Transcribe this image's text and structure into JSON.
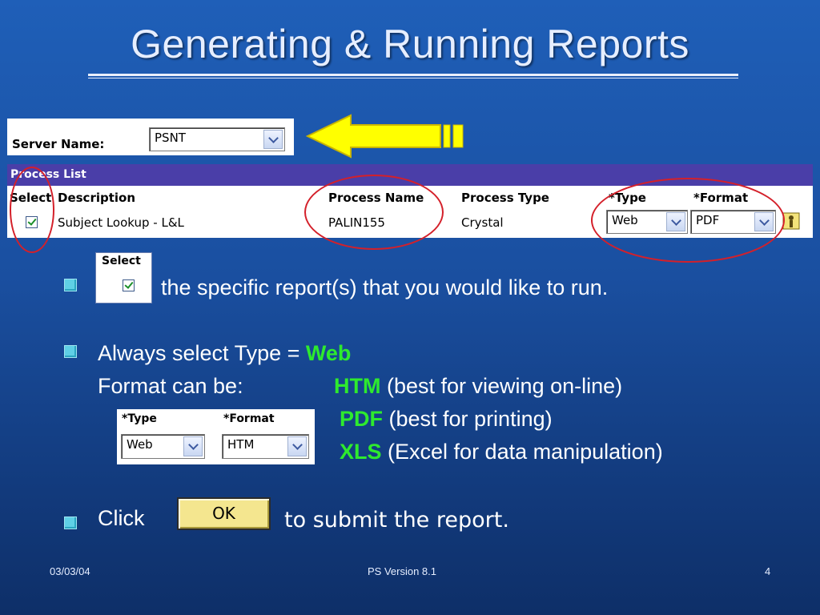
{
  "slide": {
    "title": "Generating & Running Reports",
    "page_number": "4",
    "footer_date": "03/03/04",
    "footer_center": "PS Version 8.1"
  },
  "server": {
    "label": "Server Name:",
    "value": "PSNT"
  },
  "process_list": {
    "title": "Process List",
    "headers": {
      "select": "Select",
      "description": "Description",
      "process_name": "Process Name",
      "process_type": "Process Type",
      "type": "*Type",
      "format": "*Format"
    },
    "row": {
      "description": "Subject Lookup - L&L",
      "process_name": "PALIN155",
      "process_type": "Crystal",
      "type": "Web",
      "format": "PDF"
    }
  },
  "bullets": {
    "b1_text": "the specific report(s) that you would like to run.",
    "b1_inline_label": "Select",
    "b2_line1": "Always select Type = ",
    "b2_line1_value": "Web",
    "b2_line2": "Format can be:",
    "formats": [
      {
        "name": "HTM",
        "desc": "(best for viewing on-line)"
      },
      {
        "name": "PDF",
        "desc": "(best for printing)"
      },
      {
        "name": "XLS",
        "desc": "(Excel for data manipulation)"
      }
    ],
    "b2_inline": {
      "type_label": "*Type",
      "format_label": "*Format",
      "type_value": "Web",
      "format_value": "HTM"
    },
    "b3_prefix": "Click",
    "b3_button": "OK",
    "b3_suffix": "to submit the report."
  },
  "colors": {
    "background": "#1a4fa0",
    "highlight_green": "#2eea2e",
    "arrow_yellow": "#ffff00",
    "ring_red": "#d4202a",
    "process_header": "#4a3ea8"
  }
}
